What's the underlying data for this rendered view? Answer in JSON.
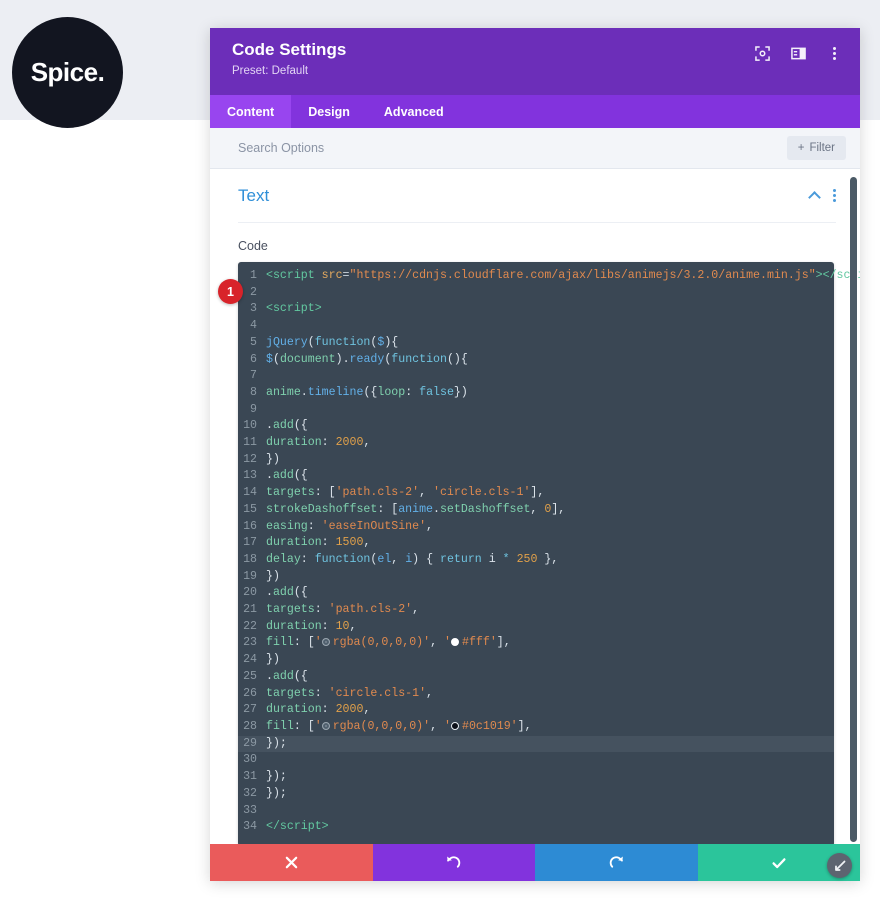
{
  "brand": {
    "logo_text": "Spice."
  },
  "modal": {
    "title": "Code Settings",
    "preset": "Preset: Default",
    "header_icons": [
      {
        "name": "focus-icon",
        "label": "Focus"
      },
      {
        "name": "layout-icon",
        "label": "Layout"
      },
      {
        "name": "more-options-icon",
        "label": "More"
      }
    ],
    "tabs": [
      {
        "label": "Content",
        "active": true
      },
      {
        "label": "Design",
        "active": false
      },
      {
        "label": "Advanced",
        "active": false
      }
    ],
    "search": {
      "placeholder": "Search Options",
      "value": ""
    },
    "filter_button": {
      "label": "Filter",
      "plus": "+"
    },
    "section": {
      "title": "Text",
      "collapse_icon": "chevron-up-icon",
      "menu_icon": "more-options-icon"
    },
    "field": {
      "label": "Code"
    },
    "badge": {
      "number": "1"
    },
    "footer": [
      {
        "name": "cancel-button",
        "icon": "close-icon",
        "color": "#ea5b5b"
      },
      {
        "name": "undo-button",
        "icon": "undo-icon",
        "color": "#8233dd"
      },
      {
        "name": "redo-button",
        "icon": "redo-icon",
        "color": "#2d8bd4"
      },
      {
        "name": "save-button",
        "icon": "check-icon",
        "color": "#2bc59b"
      }
    ]
  },
  "code": {
    "lines": [
      {
        "n": "1",
        "html": "<span class=\"t-tag\">&lt;script</span> <span class=\"t-attr\">src</span><span class=\"t-plain\">=</span><span class=\"t-str\">\"https://cdnjs.cloudflare.com/ajax/libs/animejs/3.2.0/anime.min.js\"</span><span class=\"t-tag\">&gt;&lt;/script&gt;</span>"
      },
      {
        "n": "2",
        "html": ""
      },
      {
        "n": "3",
        "html": "<span class=\"t-tag\">&lt;script&gt;</span>"
      },
      {
        "n": "4",
        "html": ""
      },
      {
        "n": "5",
        "html": "<span class=\"t-fn\">jQuery</span><span class=\"t-white\">(</span><span class=\"t-key\">function</span><span class=\"t-white\">(</span><span class=\"t-fn\">$</span><span class=\"t-white\">){</span>"
      },
      {
        "n": "6",
        "html": "<span class=\"t-fn\">$</span><span class=\"t-white\">(</span><span class=\"t-green\">document</span><span class=\"t-white\">).</span><span class=\"t-fn\">ready</span><span class=\"t-white\">(</span><span class=\"t-key\">function</span><span class=\"t-white\">(){</span>"
      },
      {
        "n": "7",
        "html": ""
      },
      {
        "n": "8",
        "html": "<span class=\"t-green\">anime</span><span class=\"t-white\">.</span><span class=\"t-fn\">timeline</span><span class=\"t-white\">({</span><span class=\"t-green\">loop</span><span class=\"t-white\">: </span><span class=\"t-key\">false</span><span class=\"t-white\">})</span>"
      },
      {
        "n": "9",
        "html": ""
      },
      {
        "n": "10",
        "html": "<span class=\"t-white\">.</span><span class=\"t-green\">add</span><span class=\"t-white\">({</span>"
      },
      {
        "n": "11",
        "html": "<span class=\"t-green\">duration</span><span class=\"t-white\">: </span><span class=\"t-num\">2000</span><span class=\"t-white\">,</span>"
      },
      {
        "n": "12",
        "html": "<span class=\"t-white\">})</span>"
      },
      {
        "n": "13",
        "html": "<span class=\"t-white\">.</span><span class=\"t-green\">add</span><span class=\"t-white\">({</span>"
      },
      {
        "n": "14",
        "html": "<span class=\"t-green\">targets</span><span class=\"t-white\">: [</span><span class=\"t-str\">'path.cls-2'</span><span class=\"t-white\">, </span><span class=\"t-str\">'circle.cls-1'</span><span class=\"t-white\">],</span>"
      },
      {
        "n": "15",
        "html": "<span class=\"t-green\">strokeDashoffset</span><span class=\"t-white\">: [</span><span class=\"t-fn\">anime</span><span class=\"t-white\">.</span><span class=\"t-green\">setDashoffset</span><span class=\"t-white\">, </span><span class=\"t-num\">0</span><span class=\"t-white\">],</span>"
      },
      {
        "n": "16",
        "html": "<span class=\"t-green\">easing</span><span class=\"t-white\">: </span><span class=\"t-str\">'easeInOutSine'</span><span class=\"t-white\">,</span>"
      },
      {
        "n": "17",
        "html": "<span class=\"t-green\">duration</span><span class=\"t-white\">: </span><span class=\"t-num\">1500</span><span class=\"t-white\">,</span>"
      },
      {
        "n": "18",
        "html": "<span class=\"t-green\">delay</span><span class=\"t-white\">: </span><span class=\"t-key\">function</span><span class=\"t-white\">(</span><span class=\"t-fn\">el</span><span class=\"t-white\">, </span><span class=\"t-fn\">i</span><span class=\"t-white\">) { </span><span class=\"t-key\">return</span><span class=\"t-white\"> i </span><span class=\"t-key\">*</span><span class=\"t-white\"> </span><span class=\"t-num\">250</span><span class=\"t-white\"> },</span>"
      },
      {
        "n": "19",
        "html": "<span class=\"t-white\">})</span>"
      },
      {
        "n": "20",
        "html": "<span class=\"t-white\">.</span><span class=\"t-green\">add</span><span class=\"t-white\">({</span>"
      },
      {
        "n": "21",
        "html": "<span class=\"t-green\">targets</span><span class=\"t-white\">: </span><span class=\"t-str\">'path.cls-2'</span><span class=\"t-white\">,</span>"
      },
      {
        "n": "22",
        "html": "<span class=\"t-green\">duration</span><span class=\"t-white\">: </span><span class=\"t-num\">10</span><span class=\"t-white\">,</span>"
      },
      {
        "n": "23",
        "html": "<span class=\"t-green\">fill</span><span class=\"t-white\">: [</span><span class=\"t-str\">'</span><span class=\"swatch sw-trans\"></span><span class=\"t-str\">rgba(0,0,0,0)'</span><span class=\"t-white\">, </span><span class=\"t-str\">'</span><span class=\"swatch sw-white\"></span><span class=\"t-str\">#fff'</span><span class=\"t-white\">],</span>"
      },
      {
        "n": "24",
        "html": "<span class=\"t-white\">})</span>"
      },
      {
        "n": "25",
        "html": "<span class=\"t-white\">.</span><span class=\"t-green\">add</span><span class=\"t-white\">({</span>"
      },
      {
        "n": "26",
        "html": "<span class=\"t-green\">targets</span><span class=\"t-white\">: </span><span class=\"t-str\">'circle.cls-1'</span><span class=\"t-white\">,</span>"
      },
      {
        "n": "27",
        "html": "<span class=\"t-green\">duration</span><span class=\"t-white\">: </span><span class=\"t-num\">2000</span><span class=\"t-white\">,</span>"
      },
      {
        "n": "28",
        "html": "<span class=\"t-green\">fill</span><span class=\"t-white\">: [</span><span class=\"t-str\">'</span><span class=\"swatch sw-trans\"></span><span class=\"t-str\">rgba(0,0,0,0)'</span><span class=\"t-white\">, </span><span class=\"t-str\">'</span><span class=\"swatch sw-dark\"></span><span class=\"t-str\">#0c1019'</span><span class=\"t-white\">],</span>"
      },
      {
        "n": "29",
        "html": "<span class=\"t-white\">});</span>",
        "highlight": true
      },
      {
        "n": "30",
        "html": ""
      },
      {
        "n": "31",
        "html": "<span class=\"t-white\">});</span>"
      },
      {
        "n": "32",
        "html": "<span class=\"t-white\">});</span>"
      },
      {
        "n": "33",
        "html": ""
      },
      {
        "n": "34",
        "html": "<span class=\"t-tag\">&lt;/script&gt;</span>"
      }
    ]
  },
  "colors": {
    "header_purple": "#6c2eb9",
    "tab_bar_purple": "#8233dd",
    "tab_active_purple": "#9845ef",
    "section_blue": "#2f8fd8",
    "editor_bg": "#3a4754",
    "badge_red": "#d8232a",
    "cancel_red": "#ea5b5b",
    "undo_purple": "#8233dd",
    "redo_blue": "#2d8bd4",
    "save_green": "#2bc59b"
  }
}
